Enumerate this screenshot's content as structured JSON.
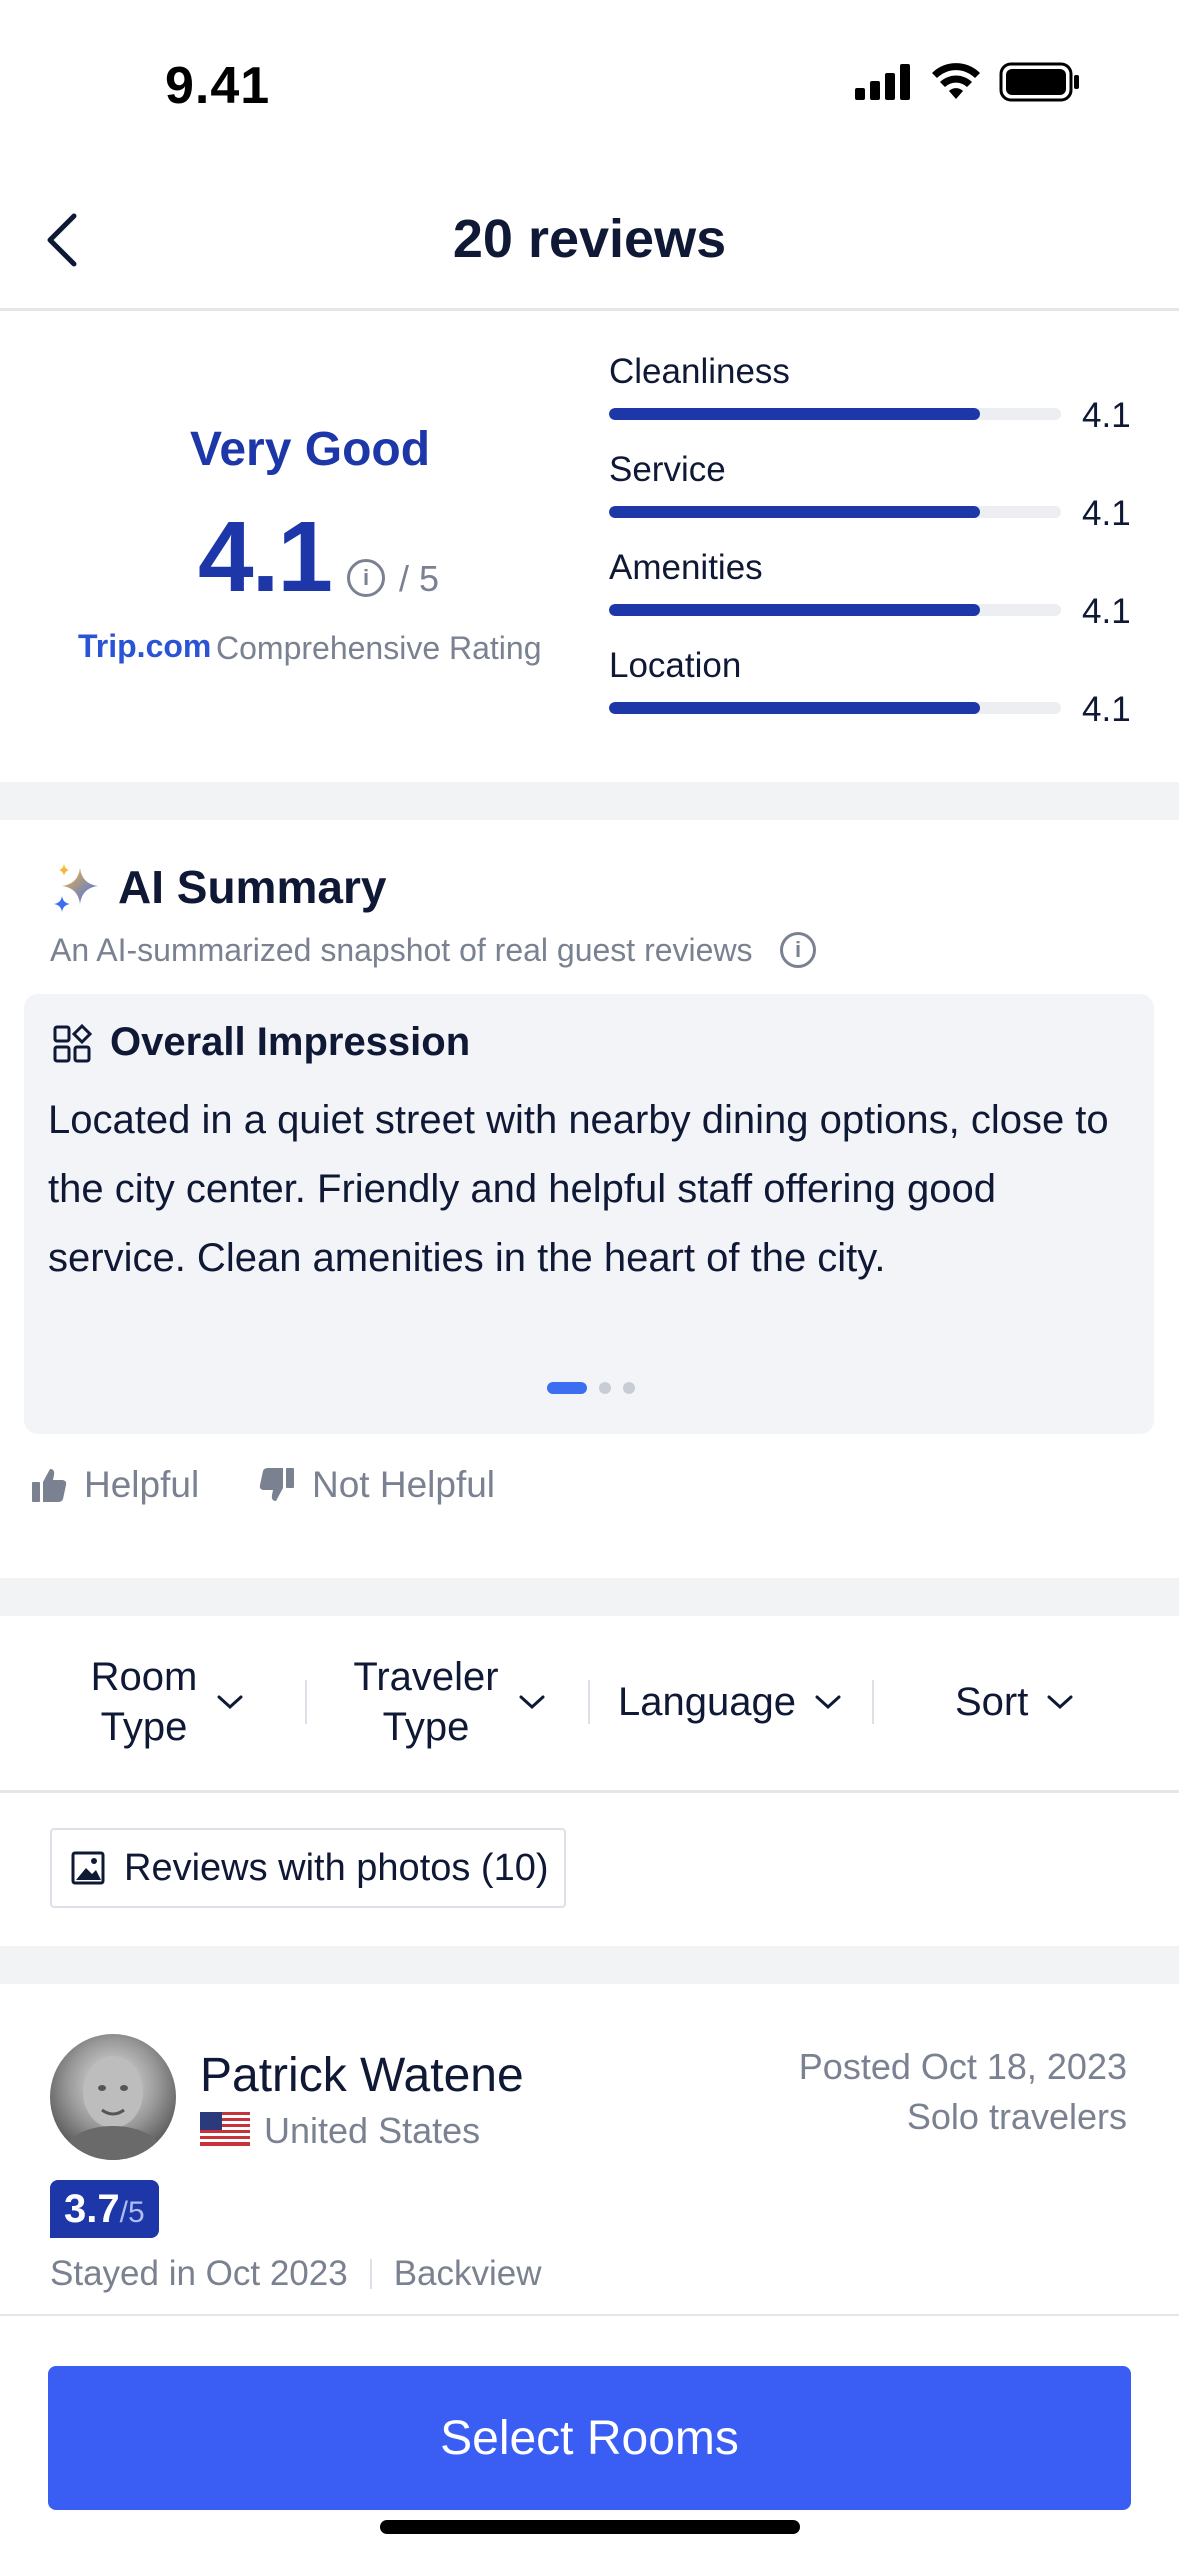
{
  "status_bar": {
    "time": "9.41"
  },
  "header": {
    "title": "20 reviews"
  },
  "rating": {
    "label": "Very Good",
    "score": "4.1",
    "max": "/ 5",
    "brand": "Trip.com",
    "caption": "Comprehensive Rating",
    "subscores": [
      {
        "label": "Cleanliness",
        "value": "4.1",
        "fraction": 0.82
      },
      {
        "label": "Service",
        "value": "4.1",
        "fraction": 0.82
      },
      {
        "label": "Amenities",
        "value": "4.1",
        "fraction": 0.82
      },
      {
        "label": "Location",
        "value": "4.1",
        "fraction": 0.82
      }
    ]
  },
  "ai_summary": {
    "title": "AI Summary",
    "subtitle": "An AI-summarized snapshot of real guest reviews",
    "card_title": "Overall Impression",
    "card_body": "Located in a quiet street with nearby dining options, close to the city center. Friendly and helpful staff offering good service. Clean amenities in the heart of the city.",
    "helpful_label": "Helpful",
    "not_helpful_label": "Not Helpful"
  },
  "filters": {
    "room_type": "Room Type",
    "traveler_type": "Traveler Type",
    "language": "Language",
    "sort": "Sort"
  },
  "photo_filter": {
    "label": "Reviews with photos (10)"
  },
  "review": {
    "name": "Patrick Watene",
    "country": "United States",
    "posted": "Posted Oct 18, 2023",
    "traveler_type": "Solo travelers",
    "score": "3.7",
    "score_max": "/5",
    "stayed": "Stayed in Oct 2023",
    "room": "Backview"
  },
  "cta": {
    "label": "Select Rooms"
  },
  "colors": {
    "accent": "#1d37a8",
    "button": "#3a5ef3"
  }
}
